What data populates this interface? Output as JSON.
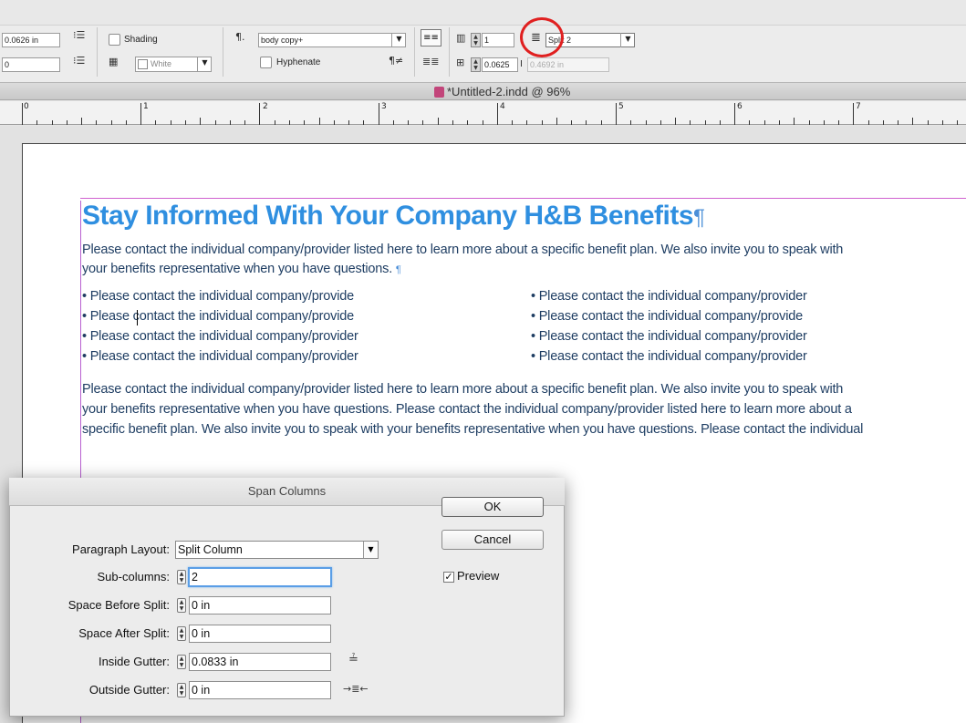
{
  "toolbar": {
    "field_space_before": "0.0626 in",
    "field_space_after": "0",
    "shading_label": "Shading",
    "shading_color": "White",
    "paragraph_style": "body copy+",
    "hyphenate_label": "Hyphenate",
    "columns_value": "1",
    "gutter_value": "0.0625",
    "span_value": "0.4692 in",
    "span_mode": "Split 2"
  },
  "window": {
    "title": "*Untitled-2.indd @ 96%"
  },
  "ruler": {
    "marks": [
      "0",
      "1",
      "2",
      "3",
      "4",
      "5",
      "6",
      "7"
    ]
  },
  "document": {
    "headline": "Stay Informed With Your Company H&B Benefits",
    "intro_line1": "Please contact the individual company/provider listed here to learn more about a specific benefit plan. We also invite you to speak with",
    "intro_line2": "your benefits representative when you have questions. ",
    "bullets_left": [
      "• Please contact the individual company/provide",
      "• Please contact the individual company/provide",
      "• Please contact the individual company/provider",
      "• Please contact the individual company/provider"
    ],
    "bullets_right": [
      "• Please contact the individual company/provider",
      "• Please contact the individual company/provide",
      "• Please contact the individual company/provider",
      "• Please contact the individual company/provider"
    ],
    "body_line1": "Please contact the individual company/provider listed here to learn more about a specific benefit plan. We also invite you to speak with",
    "body_line2": "your benefits representative when you have questions. Please contact the individual company/provider listed here to learn more about a",
    "body_line3": "specific benefit plan. We also invite you to speak with your benefits representative when you have questions. Please contact the individual"
  },
  "dialog": {
    "title": "Span Columns",
    "paragraph_layout_label": "Paragraph Layout:",
    "paragraph_layout_value": "Split Column",
    "sub_columns_label": "Sub-columns:",
    "sub_columns_value": "2",
    "space_before_label": "Space Before Split:",
    "space_before_value": "0 in",
    "space_after_label": "Space After Split:",
    "space_after_value": "0 in",
    "inside_gutter_label": "Inside Gutter:",
    "inside_gutter_value": "0.0833 in",
    "outside_gutter_label": "Outside Gutter:",
    "outside_gutter_value": "0 in",
    "ok_label": "OK",
    "cancel_label": "Cancel",
    "preview_label": "Preview",
    "preview_checked": true
  },
  "colors": {
    "headline": "#2f8fe0",
    "body_text": "#1f3e63",
    "highlight_circle": "#e02020",
    "margin_guide": "#b860d0"
  }
}
